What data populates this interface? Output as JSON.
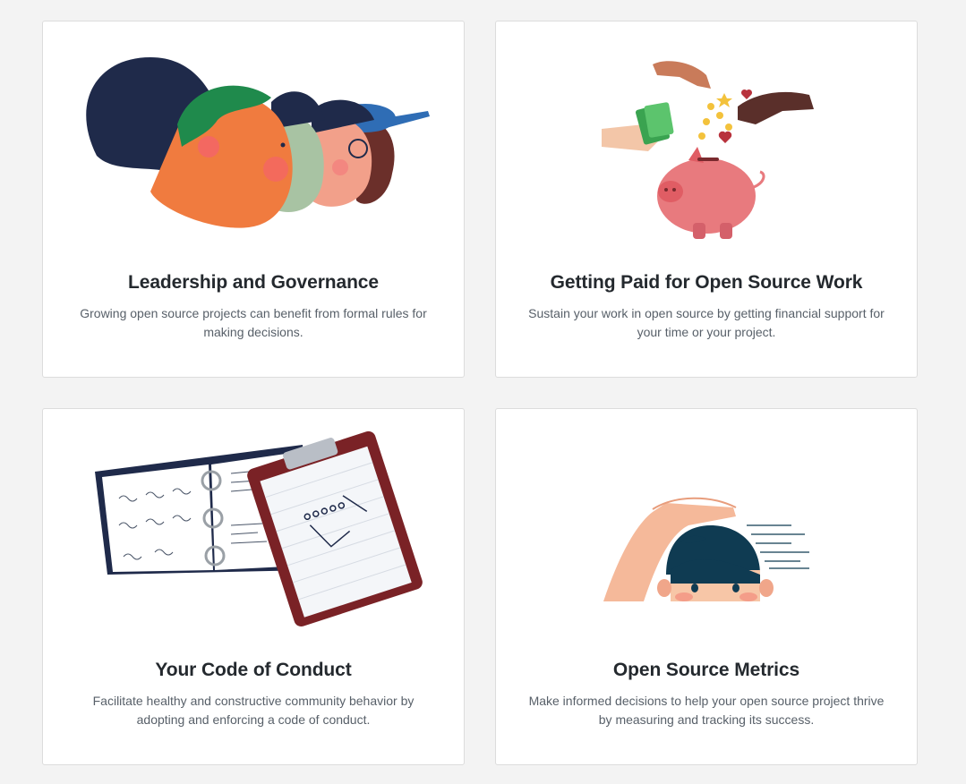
{
  "cards": [
    {
      "title": "Leadership and Governance",
      "description": "Growing open source projects can benefit from formal rules for making decisions.",
      "illustration": "diverse-people-heads"
    },
    {
      "title": "Getting Paid for Open Source Work",
      "description": "Sustain your work in open source by getting financial support for your time or your project.",
      "illustration": "piggy-bank-with-hands"
    },
    {
      "title": "Your Code of Conduct",
      "description": "Facilitate healthy and constructive community behavior by adopting and enforcing a code of conduct.",
      "illustration": "binder-and-clipboard"
    },
    {
      "title": "Open Source Metrics",
      "description": "Make informed decisions to help your open source project thrive by measuring and tracking its success.",
      "illustration": "hand-measuring-child-height"
    }
  ],
  "colors": {
    "page_background": "#f3f3f3",
    "card_background": "#ffffff",
    "card_border": "#dcdcdc",
    "title_text": "#24292e",
    "body_text": "#586069"
  }
}
